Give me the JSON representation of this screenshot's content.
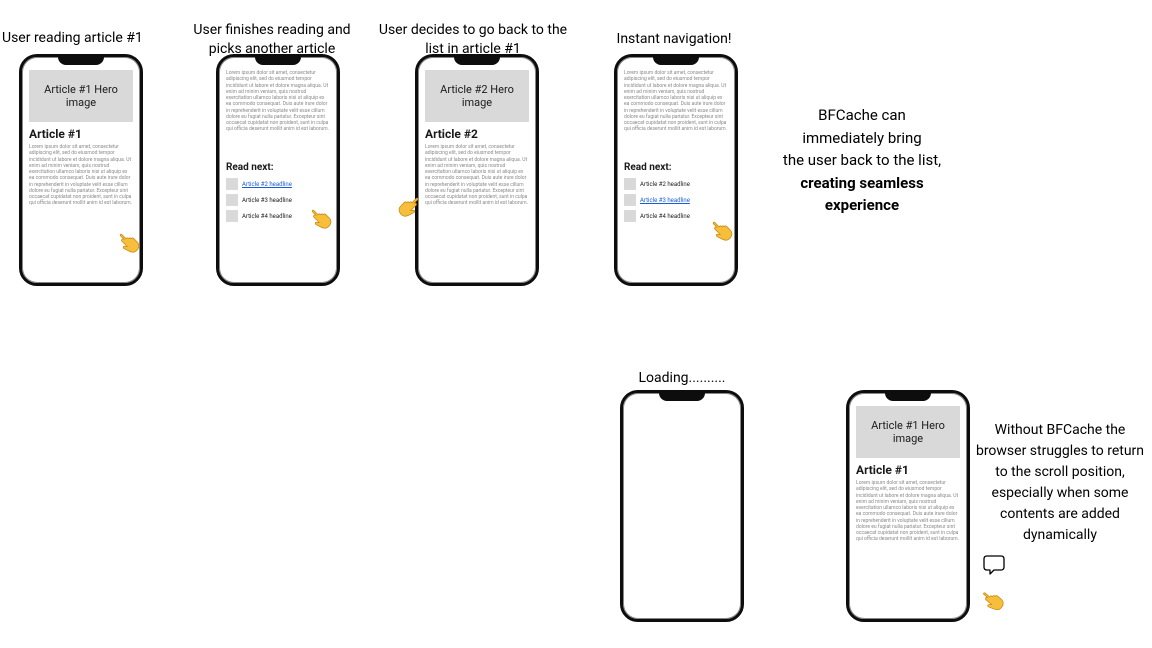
{
  "captions": {
    "c1": "User reading article #1",
    "c2": "User finishes reading and picks another article",
    "c3": "User decides to go back to the list in article #1",
    "c4": "Instant navigation!",
    "c5": "Loading.........."
  },
  "explainers": {
    "e1_l1": "BFCache can",
    "e1_l2": "immediately bring",
    "e1_l3": "the user back to the list,",
    "e1_bold_l1": "creating seamless",
    "e1_bold_l2": "experience",
    "e2_l1": "Without BFCache the",
    "e2_l2": "browser struggles to return",
    "e2_l3": "to the scroll position,",
    "e2_l4": "especially when some",
    "e2_l5": "contents are added",
    "e2_l6": "dynamically"
  },
  "screens": {
    "hero1": "Article #1 Hero image",
    "hero2": "Article #2 Hero image",
    "title1": "Article #1",
    "title2": "Article #2",
    "readnext_heading": "Read next:",
    "rn_a2": "Article #2 headline",
    "rn_a3": "Article #3 headline",
    "rn_a4": "Article #4 headline"
  },
  "lorem_short": "Lorem ipsum dolor sit amet, consectetur adipiscing elit, sed do eiusmod tempor incididunt ut labore et dolore magna aliqua. Ut enim ad minim veniam, quis nostrud exercitation ullamco laboris nisi ut aliquip ex ea commodo consequat. Duis aute irure dolor in reprehenderit in voluptate velit esse cillum dolore eu fugiat nulla pariatur. Excepteur sint occaecat cupidatat non proident, sunt in culpa qui officia deserunt mollit anim id est laborum.",
  "lorem_long": "Lorem ipsum dolor sit amet, consectetur adipiscing elit, sed do eiusmod tempor incididunt ut labore et dolore magna aliqua. Ut enim ad minim veniam, quis nostrud exercitation ullamco laboris nisi ut aliquip ex ea commodo consequat. Duis aute irure dolor in reprehenderit in voluptate velit esse cillum dolore eu fugiat nulla pariatur. Excepteur sint occaecat cupidatat non proident, sunt in culpa qui officia deserunt mollit anim id est laborum."
}
